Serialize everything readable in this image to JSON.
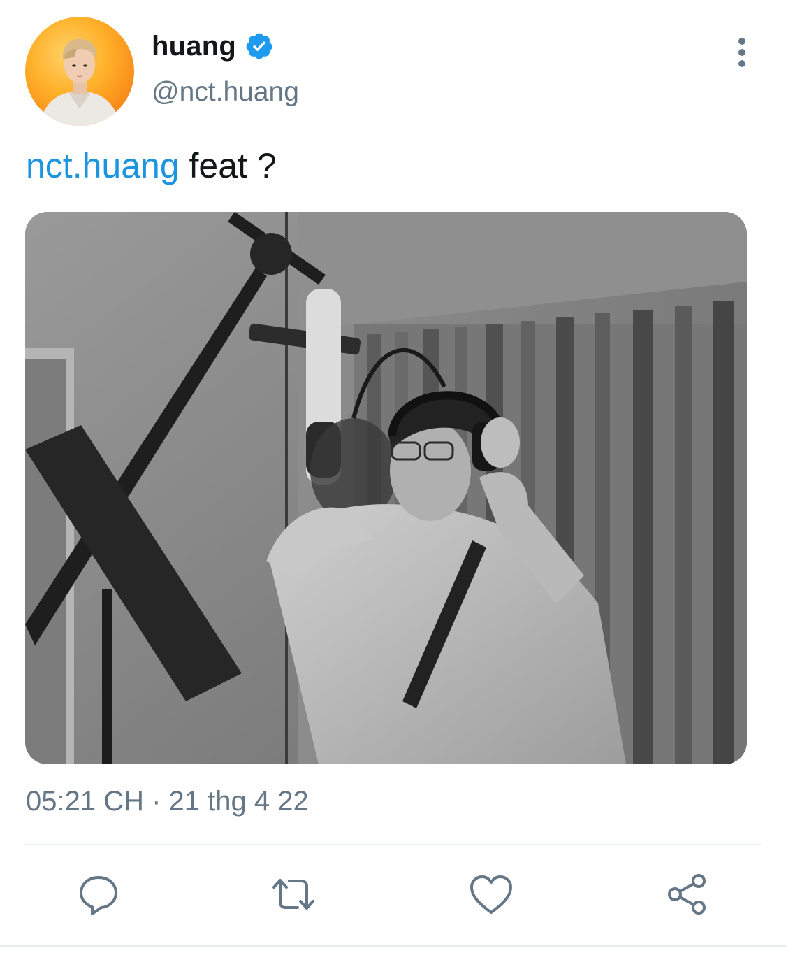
{
  "author": {
    "display_name": "huang",
    "handle": "@nct.huang",
    "verified": true
  },
  "tweet": {
    "mention": "nct.huang",
    "text": " feat ?",
    "timestamp": "05:21 CH · 21 thg 4 22"
  },
  "icons": {
    "verified": "verified-badge-icon",
    "more": "more-vertical-icon",
    "reply": "reply-bubble-icon",
    "retweet": "retweet-icon",
    "like": "heart-icon",
    "share": "share-icon"
  },
  "colors": {
    "accent": "#1b95e0",
    "verified": "#1d9bf0",
    "secondary_text": "#657786",
    "divider": "#e6ecf0"
  }
}
